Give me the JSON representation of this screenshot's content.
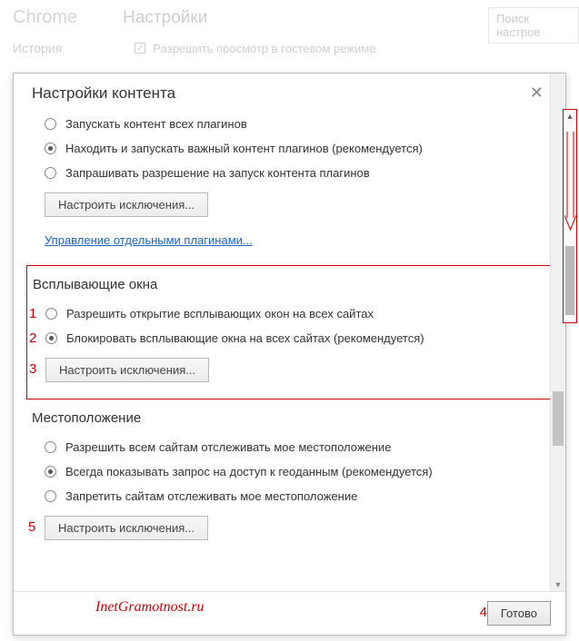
{
  "background": {
    "app_name": "Chrome",
    "page_title": "Настройки",
    "search_placeholder": "Поиск настрое",
    "history_label": "История",
    "guest_mode_label": "Разрешить просмотр в гостевом режиме"
  },
  "dialog": {
    "title": "Настройки контента",
    "plugins": {
      "opt_run_all": "Запускать контент всех плагинов",
      "opt_detect_important": "Находить и запускать важный контент плагинов (рекомендуется)",
      "opt_ask": "Запрашивать разрешение на запуск контента плагинов",
      "exceptions_btn": "Настроить исключения...",
      "manage_link": "Управление отдельными плагинами..."
    },
    "popups": {
      "title": "Всплывающие окна",
      "opt_allow": "Разрешить открытие всплывающих окон на всех сайтах",
      "opt_block": "Блокировать всплывающие окна на всех сайтах (рекомендуется)",
      "exceptions_btn": "Настроить исключения..."
    },
    "location": {
      "title": "Местоположение",
      "opt_allow": "Разрешить всем сайтам отслеживать мое местоположение",
      "opt_ask": "Всегда показывать запрос на доступ к геоданным (рекомендуется)",
      "opt_deny": "Запретить сайтам отслеживать мое местоположение",
      "exceptions_btn": "Настроить исключения..."
    },
    "done_btn": "Готово"
  },
  "annotations": {
    "n1": "1",
    "n2": "2",
    "n3": "3",
    "n4": "4",
    "n5": "5",
    "watermark": "InetGramotnost.ru"
  }
}
